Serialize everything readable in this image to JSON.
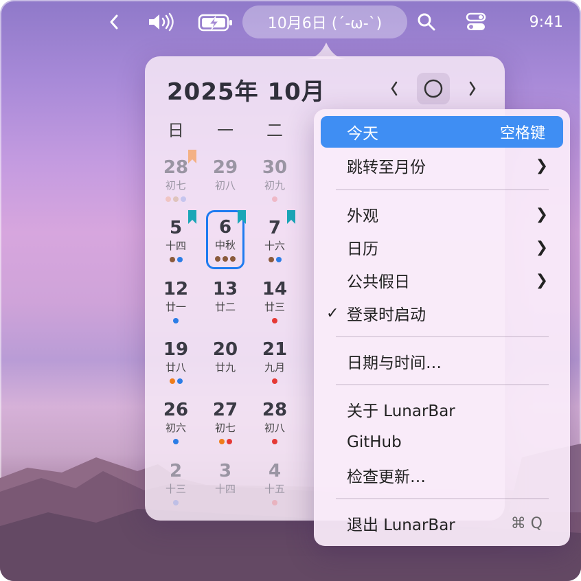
{
  "menubar": {
    "date_label": "10月6日 (´-ω-`)",
    "time": "9:41",
    "icons": [
      "chevron-left-icon",
      "volume-icon",
      "battery-charging-icon",
      "search-icon",
      "control-center-icon"
    ]
  },
  "calendar": {
    "title": "2025年 10月",
    "today_button_icon": "circle-icon",
    "weekdays": [
      "日",
      "一",
      "二"
    ],
    "rows": [
      [
        {
          "day": "28",
          "lunar": "初七",
          "dots": [
            "#f0a78a",
            "#c9a37a",
            "#93a7e8"
          ],
          "dim": true
        },
        {
          "day": "29",
          "lunar": "初八",
          "dots": [],
          "dim": true
        },
        {
          "day": "30",
          "lunar": "初九",
          "dots": [
            "#ee8b93"
          ],
          "dim": true
        }
      ],
      [
        {
          "day": "5",
          "lunar": "十四",
          "dots": [
            "#8a5a3c",
            "#2b7de6"
          ],
          "dim": false
        },
        {
          "day": "6",
          "lunar": "中秋",
          "dots": [
            "#8a5a3c",
            "#8a5a3c",
            "#8a5a3c"
          ],
          "dim": false,
          "selected": true
        },
        {
          "day": "7",
          "lunar": "十六",
          "dots": [
            "#8a5a3c",
            "#2b7de6"
          ],
          "dim": false
        }
      ],
      [
        {
          "day": "12",
          "lunar": "廿一",
          "dots": [
            "#2b7de6"
          ],
          "dim": false
        },
        {
          "day": "13",
          "lunar": "廿二",
          "dots": [],
          "dim": false
        },
        {
          "day": "14",
          "lunar": "廿三",
          "dots": [
            "#e53935"
          ],
          "dim": false
        }
      ],
      [
        {
          "day": "19",
          "lunar": "廿八",
          "dots": [
            "#ef7d1a",
            "#2b7de6"
          ],
          "dim": false
        },
        {
          "day": "20",
          "lunar": "廿九",
          "dots": [],
          "dim": false
        },
        {
          "day": "21",
          "lunar": "九月",
          "dots": [
            "#e53935"
          ],
          "dim": false
        }
      ],
      [
        {
          "day": "26",
          "lunar": "初六",
          "dots": [
            "#2b7de6"
          ],
          "dim": false
        },
        {
          "day": "27",
          "lunar": "初七",
          "dots": [
            "#ef7d1a",
            "#e53935"
          ],
          "dim": false
        },
        {
          "day": "28",
          "lunar": "初八",
          "dots": [
            "#e53935"
          ],
          "dim": false
        }
      ],
      [
        {
          "day": "2",
          "lunar": "十三",
          "dots": [
            "#93a7e8"
          ],
          "dim": true
        },
        {
          "day": "3",
          "lunar": "十四",
          "dots": [],
          "dim": true
        },
        {
          "day": "4",
          "lunar": "十五",
          "dots": [
            "#ee8b93"
          ],
          "dim": true
        }
      ]
    ],
    "bookmark_colors": {
      "holiday": "#f4b184",
      "event": "#1aa6b7"
    }
  },
  "menu": {
    "today": {
      "label": "今天",
      "shortcut": "空格键"
    },
    "jump_month": "跳转至月份",
    "appearance": "外观",
    "calendars": "日历",
    "holidays": "公共假日",
    "launch_at_login": "登录时启动",
    "date_time": "日期与时间…",
    "about": "关于 LunarBar",
    "github": "GitHub",
    "check_updates": "检查更新…",
    "quit": {
      "label": "退出 LunarBar",
      "shortcut": "⌘ Q"
    }
  }
}
